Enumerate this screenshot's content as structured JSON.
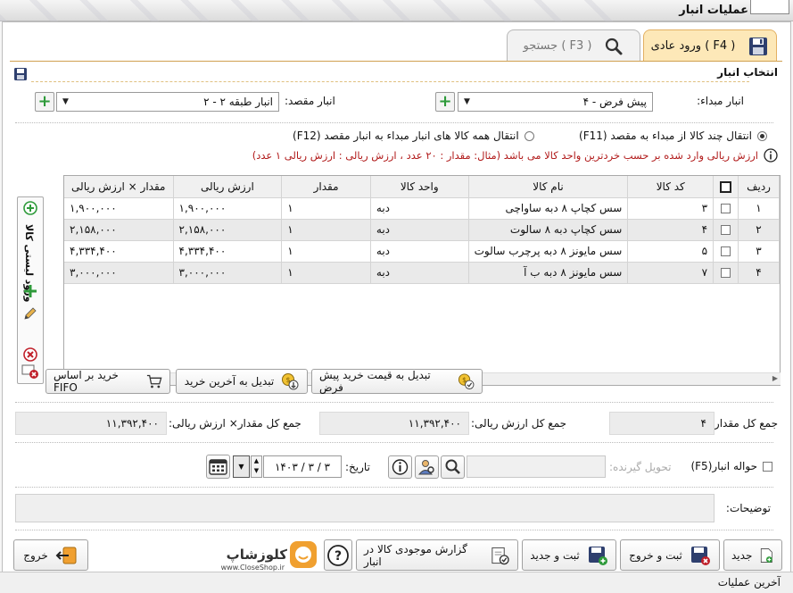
{
  "window": {
    "title": "عملیات انبار"
  },
  "tabs": [
    {
      "label": "ورود عادی ( F4 )",
      "active": true
    },
    {
      "label": "جستجو ( F3 )",
      "active": false
    }
  ],
  "section": {
    "title": "انتخاب انبار"
  },
  "source_warehouse": {
    "label": "انبار مبداء:",
    "value": "پیش فرض - ۴"
  },
  "dest_warehouse": {
    "label": "انبار مقصد:",
    "value": "انبار طبقه ۲ - ۲"
  },
  "transfer_options": {
    "option1": "انتقال چند کالا از مبداء به مقصد (F11)",
    "option2": "انتقال همه کالا های انبار مبداء به انبار مقصد (F12)",
    "note": "ارزش ریالی  وارد شده بر حسب خردترین واحد کالا می باشد (مثال:  مقدار : ۲۰ عدد  ،  ارزش ریالی : ارزش ریالی ۱ عدد)"
  },
  "grid": {
    "headers": [
      "ردیف",
      "",
      "کد کالا",
      "نام کالا",
      "واحد کالا",
      "مقدار",
      "ارزش ریالی",
      "مقدار × ارزش ریالی"
    ],
    "rows": [
      {
        "row": "۱",
        "code": "۳",
        "name": "سس کچاپ ۸ دبه ساواچی",
        "unit": "دبه",
        "qty": "۱",
        "value": "۱,۹۰۰,۰۰۰",
        "total": "۱,۹۰۰,۰۰۰"
      },
      {
        "row": "۲",
        "code": "۴",
        "name": "سس کچاپ دبه ۸ سالوت",
        "unit": "دبه",
        "qty": "۱",
        "value": "۲,۱۵۸,۰۰۰",
        "total": "۲,۱۵۸,۰۰۰"
      },
      {
        "row": "۳",
        "code": "۵",
        "name": "سس مایونز ۸ دبه پرچرب سالوت",
        "unit": "دبه",
        "qty": "۱",
        "value": "۴,۳۳۴,۴۰۰",
        "total": "۴,۳۳۴,۴۰۰"
      },
      {
        "row": "۴",
        "code": "۷",
        "name": "سس مایونز ۸ دبه ب آ",
        "unit": "دبه",
        "qty": "۱",
        "value": "۳,۰۰۰,۰۰۰",
        "total": "۳,۰۰۰,۰۰۰"
      }
    ]
  },
  "sidebar": {
    "label": "ورود لیستی کالا"
  },
  "price_buttons": {
    "default_price": "تبدیل به قیمت خرید پیش فرض",
    "last_purchase": "تبدیل به آخرین خرید",
    "fifo": "خرید بر اساس FIFO"
  },
  "totals": {
    "qty_label": "جمع کل مقدار:",
    "qty_value": "۴",
    "value_label": "جمع کل ارزش ریالی:",
    "value_value": "۱۱,۳۹۲,۴۰۰",
    "qtyvalue_label": "جمع کل مقدار× ارزش ریالی:",
    "qtyvalue_value": "۱۱,۳۹۲,۴۰۰"
  },
  "transfer": {
    "havaleh_label": "حواله انبار(F5)",
    "receiver_placeholder": "تحویل گیرنده:",
    "date_label": "تاریخ:",
    "date_value": "۱۴۰۳ / ۳ / ۳"
  },
  "description": {
    "label": "توضیحات:"
  },
  "actions": {
    "new": "جدید",
    "save_exit": "ثبت و خروج",
    "save_new": "ثبت و جدید",
    "report": "گزارش موجودی کالا در انبار",
    "exit": "خروج"
  },
  "logo": {
    "brand": "کلوزشاپ",
    "url": "www.CloseShop.ir"
  },
  "status_bar": {
    "text": "آخرین عملیات"
  },
  "colors": {
    "accent_tab": "#fde8b8",
    "note_text": "#b11a1a",
    "plus_green": "#2e9a3a"
  }
}
